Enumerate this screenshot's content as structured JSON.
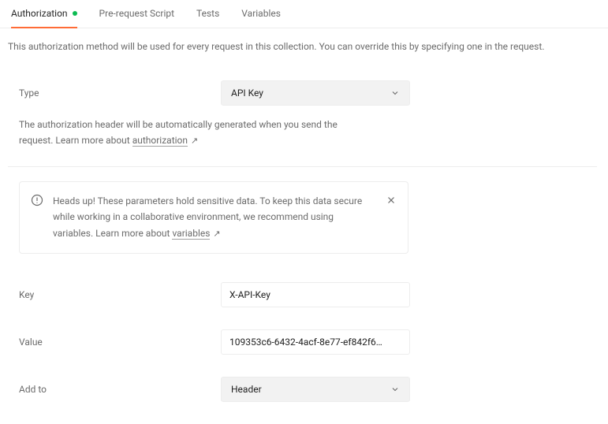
{
  "tabs": {
    "authorization": "Authorization",
    "pre_request": "Pre-request Script",
    "tests": "Tests",
    "variables": "Variables"
  },
  "description": "This authorization method will be used for every request in this collection. You can override this by specifying one in the request.",
  "type": {
    "label": "Type",
    "value": "API Key"
  },
  "helper": {
    "prefix": "The authorization header will be automatically generated when you send the request. Learn more about ",
    "link_text": "authorization"
  },
  "notice": {
    "prefix": "Heads up! These parameters hold sensitive data. To keep this data secure while working in a collaborative environment, we recommend using variables. Learn more about ",
    "link_text": "variables"
  },
  "fields": {
    "key": {
      "label": "Key",
      "value": "X-API-Key"
    },
    "value": {
      "label": "Value",
      "value": "109353c6-6432-4acf-8e77-ef842f6…"
    },
    "add_to": {
      "label": "Add to",
      "value": "Header"
    }
  }
}
